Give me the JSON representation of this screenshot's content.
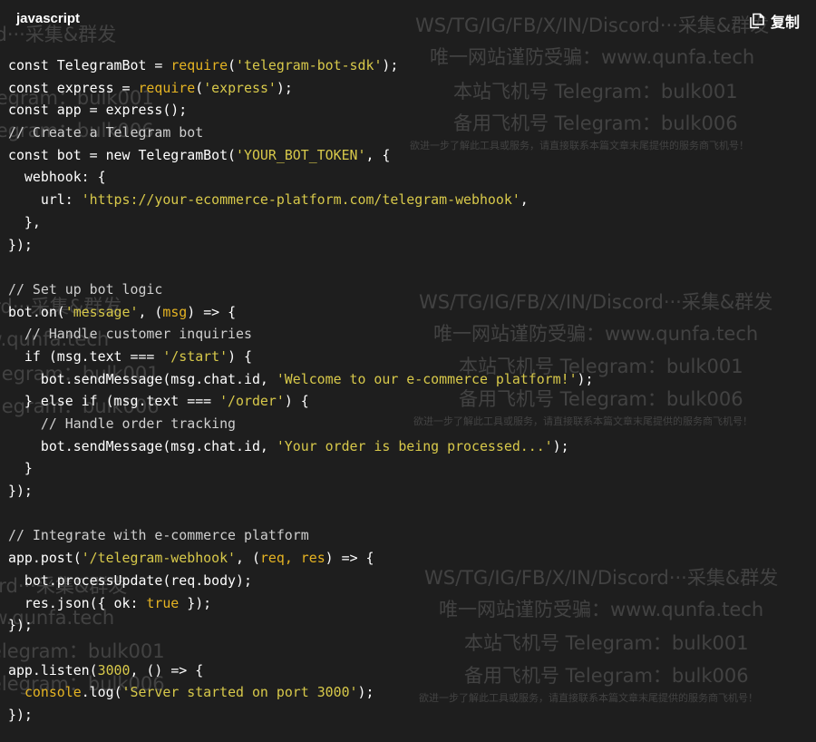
{
  "header": {
    "language": "javascript",
    "copy_label": "复制"
  },
  "code_lines": [
    [
      {
        "t": "const TelegramBot = "
      },
      {
        "t": "require",
        "c": "p"
      },
      {
        "t": "("
      },
      {
        "t": "'telegram-bot-sdk'",
        "c": "s"
      },
      {
        "t": ");"
      }
    ],
    [
      {
        "t": "const express = "
      },
      {
        "t": "require",
        "c": "p"
      },
      {
        "t": "("
      },
      {
        "t": "'express'",
        "c": "s"
      },
      {
        "t": ");"
      }
    ],
    [
      {
        "t": "const app = express();"
      }
    ],
    [
      {
        "t": "// Create a Telegram bot",
        "c": "c"
      }
    ],
    [
      {
        "t": "const bot = new TelegramBot("
      },
      {
        "t": "'YOUR_BOT_TOKEN'",
        "c": "s"
      },
      {
        "t": ", {"
      }
    ],
    [
      {
        "t": "  webhook: {"
      }
    ],
    [
      {
        "t": "    url: "
      },
      {
        "t": "'https://your-ecommerce-platform.com/telegram-webhook'",
        "c": "s"
      },
      {
        "t": ","
      }
    ],
    [
      {
        "t": "  },"
      }
    ],
    [
      {
        "t": "});"
      }
    ],
    [
      {
        "t": ""
      }
    ],
    [
      {
        "t": "// Set up bot logic",
        "c": "c"
      }
    ],
    [
      {
        "t": "bot.on("
      },
      {
        "t": "'message'",
        "c": "s"
      },
      {
        "t": ", ("
      },
      {
        "t": "msg",
        "c": "p"
      },
      {
        "t": ") => {"
      }
    ],
    [
      {
        "t": "  // Handle customer inquiries",
        "c": "c"
      }
    ],
    [
      {
        "t": "  if (msg.text === "
      },
      {
        "t": "'/start'",
        "c": "s"
      },
      {
        "t": ") {"
      }
    ],
    [
      {
        "t": "    bot.sendMessage(msg.chat.id, "
      },
      {
        "t": "'Welcome to our e-commerce platform!'",
        "c": "s"
      },
      {
        "t": ");"
      }
    ],
    [
      {
        "t": "  } else if (msg.text === "
      },
      {
        "t": "'/order'",
        "c": "s"
      },
      {
        "t": ") {"
      }
    ],
    [
      {
        "t": "    // Handle order tracking",
        "c": "c"
      }
    ],
    [
      {
        "t": "    bot.sendMessage(msg.chat.id, "
      },
      {
        "t": "'Your order is being processed...'",
        "c": "s"
      },
      {
        "t": ");"
      }
    ],
    [
      {
        "t": "  }"
      }
    ],
    [
      {
        "t": "});"
      }
    ],
    [
      {
        "t": ""
      }
    ],
    [
      {
        "t": "// Integrate with e-commerce platform",
        "c": "c"
      }
    ],
    [
      {
        "t": "app.post("
      },
      {
        "t": "'/telegram-webhook'",
        "c": "s"
      },
      {
        "t": ", ("
      },
      {
        "t": "req, res",
        "c": "p"
      },
      {
        "t": ") => {"
      }
    ],
    [
      {
        "t": "  bot.processUpdate(req.body);"
      }
    ],
    [
      {
        "t": "  res.json({ ok: "
      },
      {
        "t": "true",
        "c": "p"
      },
      {
        "t": " });"
      }
    ],
    [
      {
        "t": "});"
      }
    ],
    [
      {
        "t": ""
      }
    ],
    [
      {
        "t": "app.listen("
      },
      {
        "t": "3000",
        "c": "n"
      },
      {
        "t": ", () => {"
      }
    ],
    [
      {
        "t": "  "
      },
      {
        "t": "console",
        "c": "p"
      },
      {
        "t": ".log("
      },
      {
        "t": "'Server started on port 3000'",
        "c": "s"
      },
      {
        "t": ");"
      }
    ],
    [
      {
        "t": "});"
      }
    ]
  ],
  "watermark": {
    "line1": "WS/TG/IG/FB/X/IN/Discord···采集&群发",
    "line2": "唯一网站谨防受骗：www.qunfa.tech",
    "line3": "本站飞机号 Telegram：bulk001",
    "line4": "备用飞机号 Telegram：bulk006",
    "line5": "欲进一步了解此工具或服务，请直接联系本篇文章末尾提供的服务商飞机号！"
  },
  "colors": {
    "background": "#1e1e1e",
    "string": "#d8c94a",
    "keyword_highlight": "#e6b422",
    "comment": "#cfcfcf"
  }
}
